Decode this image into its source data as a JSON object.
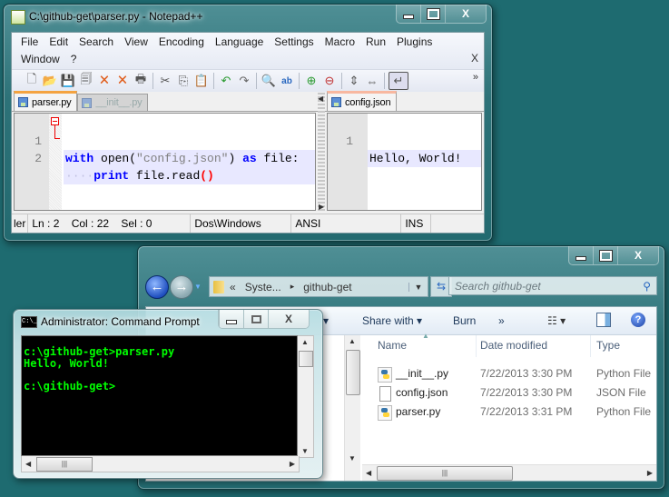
{
  "notepad": {
    "title": "C:\\github-get\\parser.py - Notepad++",
    "menu_row1": [
      "File",
      "Edit",
      "Search",
      "View",
      "Encoding",
      "Language",
      "Settings",
      "Macro",
      "Run",
      "Plugins"
    ],
    "menu_row2": [
      "Window",
      "?"
    ],
    "menu_close": "X",
    "toolbar_icons": [
      "new-file-icon",
      "open-file-icon",
      "save-icon",
      "save-all-icon",
      "close-icon",
      "close-all-icon",
      "print-icon",
      "cut-icon",
      "copy-icon",
      "paste-icon",
      "undo-icon",
      "redo-icon",
      "find-icon",
      "replace-icon",
      "zoom-in-icon",
      "zoom-out-icon",
      "sync-vertical-icon",
      "sync-horizontal-icon",
      "word-wrap-icon"
    ],
    "toolbar_more": "»",
    "left_tabs": [
      {
        "label": "parser.py",
        "active": true
      },
      {
        "label": "__init__.py",
        "active": false
      }
    ],
    "right_tabs": [
      {
        "label": "config.json",
        "active": true
      }
    ],
    "left_editor": {
      "lines": [
        {
          "num": "1",
          "kw1": "with",
          "t1": " open(",
          "str": "\"config.json\"",
          "t2": ") ",
          "kw2": "as",
          "t3": " file:"
        },
        {
          "num": "2",
          "ws": "····",
          "kw1": "print",
          "t1": " file.read",
          "paren": "()"
        }
      ]
    },
    "right_editor": {
      "lines": [
        {
          "num": "1",
          "text": "Hello, World!"
        }
      ]
    },
    "status": {
      "type_fragment": "ler",
      "position": "Ln : 2    Col : 22    Sel : 0",
      "eol": "Dos\\Windows",
      "encoding": "ANSI",
      "mode": "INS"
    }
  },
  "explorer": {
    "breadcrumb": [
      "«",
      "Syste...",
      "▸",
      "github-get"
    ],
    "search_placeholder": "Search github-get",
    "commands": {
      "share": "Share with ▾",
      "burn": "Burn",
      "more": "»",
      "hidden_left": "▾"
    },
    "columns": [
      "Name",
      "Date modified",
      "Type"
    ],
    "files": [
      {
        "name": "__init__.py",
        "date": "7/22/2013 3:30 PM",
        "type": "Python File",
        "icon": "python-file-icon"
      },
      {
        "name": "config.json",
        "date": "7/22/2013 3:30 PM",
        "type": "JSON File",
        "icon": "document-icon"
      },
      {
        "name": "parser.py",
        "date": "7/22/2013 3:31 PM",
        "type": "Python File",
        "icon": "python-file-icon"
      }
    ]
  },
  "cmd": {
    "title": "Administrator: Command Prompt",
    "icon_text": "C:\\_",
    "output": "c:\\github-get>parser.py\nHello, World!\n\nc:\\github-get>"
  },
  "captions": {
    "min": "—",
    "max": "□",
    "close": "X"
  }
}
